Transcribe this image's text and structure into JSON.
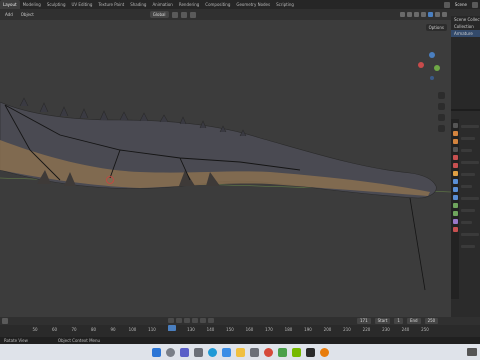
{
  "workspace_tabs": [
    "Layout",
    "Modeling",
    "Sculpting",
    "UV Editing",
    "Texture Paint",
    "Shading",
    "Animation",
    "Rendering",
    "Compositing",
    "Geometry Nodes",
    "Scripting"
  ],
  "active_workspace": "Layout",
  "scene_label": "Scene",
  "viewport_header": {
    "menu_add": "Add",
    "menu_object": "Object",
    "transform_orientation": "Global"
  },
  "options_label": "Options",
  "outliner_rows": [
    "Scene Collection",
    "Collection",
    "Armature"
  ],
  "timeline": {
    "current_frame": "120",
    "start_label": "Start",
    "start_value": "1",
    "end_label": "End",
    "end_value": "250",
    "frame_field": "171",
    "ticks": [
      "50",
      "60",
      "70",
      "80",
      "90",
      "100",
      "110",
      "120",
      "130",
      "140",
      "150",
      "160",
      "170",
      "180",
      "190",
      "200",
      "210",
      "220",
      "230",
      "240",
      "250"
    ]
  },
  "status": {
    "left": "Rotate View",
    "right": "Object Context Menu"
  },
  "colors": {
    "accent": "#4a7fc0",
    "axis_x": "#c84b4b",
    "axis_y": "#6fa846",
    "axis_z": "#4a7fc0"
  }
}
